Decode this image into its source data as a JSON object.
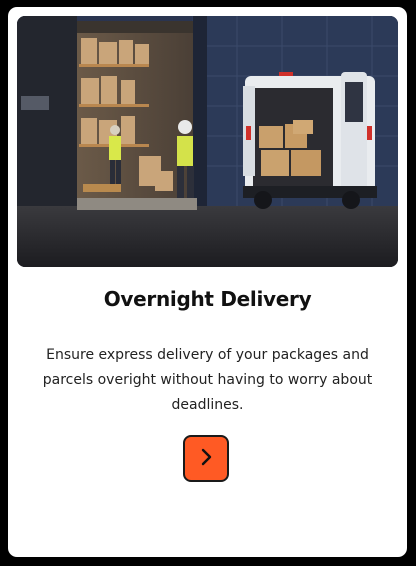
{
  "card": {
    "image_alt": "Workers loading boxes into a delivery van at a warehouse at night",
    "title": "Overnight Delivery",
    "description": "Ensure express delivery of your packages and parcels overight without having to worry about deadlines.",
    "button_icon": "chevron-right-icon"
  },
  "colors": {
    "accent": "#ff5a24",
    "card_background": "#ffffff",
    "page_background": "#000000"
  }
}
